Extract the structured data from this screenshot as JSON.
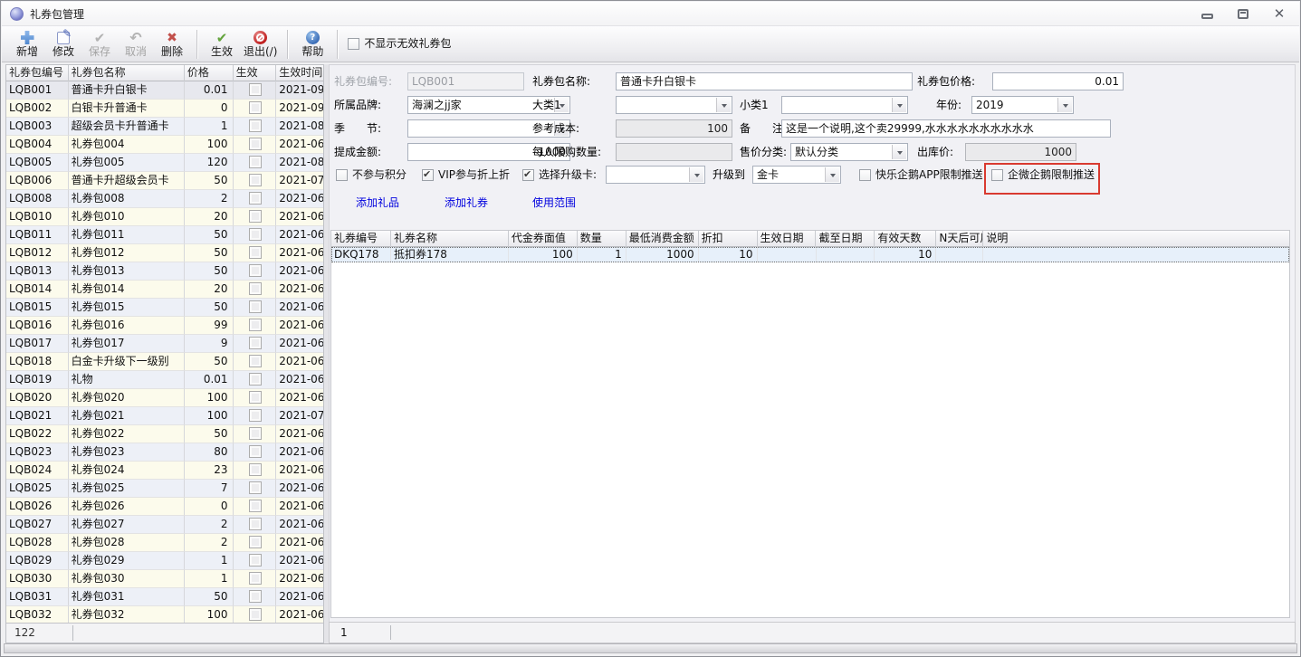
{
  "window": {
    "title": "礼券包管理"
  },
  "toolbar": {
    "buttons": [
      {
        "label": "新增",
        "enabled": true
      },
      {
        "label": "修改",
        "enabled": true
      },
      {
        "label": "保存",
        "enabled": false
      },
      {
        "label": "取消",
        "enabled": false
      },
      {
        "label": "删除",
        "enabled": true
      },
      {
        "label": "生效",
        "enabled": true
      },
      {
        "label": "退出(/)",
        "enabled": true
      },
      {
        "label": "帮助",
        "enabled": true
      }
    ],
    "filter_checkbox": {
      "label": "不显示无效礼券包",
      "checked": false
    }
  },
  "left_table": {
    "columns": [
      "礼券包编号",
      "礼券包名称",
      "价格",
      "生效",
      "生效时间"
    ],
    "footer_count": "122",
    "rows": [
      {
        "code": "LQB001",
        "name": "普通卡升白银卡",
        "price": "0.01",
        "active": false,
        "date": "2021-09"
      },
      {
        "code": "LQB002",
        "name": "白银卡升普通卡",
        "price": "0",
        "active": false,
        "date": "2021-09"
      },
      {
        "code": "LQB003",
        "name": "超级会员卡升普通卡",
        "price": "1",
        "active": false,
        "date": "2021-08"
      },
      {
        "code": "LQB004",
        "name": "礼券包004",
        "price": "100",
        "active": false,
        "date": "2021-06"
      },
      {
        "code": "LQB005",
        "name": "礼券包005",
        "price": "120",
        "active": false,
        "date": "2021-08"
      },
      {
        "code": "LQB006",
        "name": "普通卡升超级会员卡",
        "price": "50",
        "active": false,
        "date": "2021-07"
      },
      {
        "code": "LQB008",
        "name": "礼券包008",
        "price": "2",
        "active": false,
        "date": "2021-06"
      },
      {
        "code": "LQB010",
        "name": "礼券包010",
        "price": "20",
        "active": false,
        "date": "2021-06"
      },
      {
        "code": "LQB011",
        "name": "礼券包011",
        "price": "50",
        "active": false,
        "date": "2021-06"
      },
      {
        "code": "LQB012",
        "name": "礼券包012",
        "price": "50",
        "active": false,
        "date": "2021-06"
      },
      {
        "code": "LQB013",
        "name": "礼券包013",
        "price": "50",
        "active": false,
        "date": "2021-06"
      },
      {
        "code": "LQB014",
        "name": "礼券包014",
        "price": "20",
        "active": false,
        "date": "2021-06"
      },
      {
        "code": "LQB015",
        "name": "礼券包015",
        "price": "50",
        "active": false,
        "date": "2021-06"
      },
      {
        "code": "LQB016",
        "name": "礼券包016",
        "price": "99",
        "active": false,
        "date": "2021-06"
      },
      {
        "code": "LQB017",
        "name": "礼券包017",
        "price": "9",
        "active": false,
        "date": "2021-06"
      },
      {
        "code": "LQB018",
        "name": "白金卡升级下一级别",
        "price": "50",
        "active": false,
        "date": "2021-06"
      },
      {
        "code": "LQB019",
        "name": "礼物",
        "price": "0.01",
        "active": false,
        "date": "2021-06"
      },
      {
        "code": "LQB020",
        "name": "礼券包020",
        "price": "100",
        "active": false,
        "date": "2021-06"
      },
      {
        "code": "LQB021",
        "name": "礼券包021",
        "price": "100",
        "active": false,
        "date": "2021-07"
      },
      {
        "code": "LQB022",
        "name": "礼券包022",
        "price": "50",
        "active": false,
        "date": "2021-06"
      },
      {
        "code": "LQB023",
        "name": "礼券包023",
        "price": "80",
        "active": false,
        "date": "2021-06"
      },
      {
        "code": "LQB024",
        "name": "礼券包024",
        "price": "23",
        "active": false,
        "date": "2021-06"
      },
      {
        "code": "LQB025",
        "name": "礼券包025",
        "price": "7",
        "active": false,
        "date": "2021-06"
      },
      {
        "code": "LQB026",
        "name": "礼券包026",
        "price": "0",
        "active": false,
        "date": "2021-06"
      },
      {
        "code": "LQB027",
        "name": "礼券包027",
        "price": "2",
        "active": false,
        "date": "2021-06"
      },
      {
        "code": "LQB028",
        "name": "礼券包028",
        "price": "2",
        "active": false,
        "date": "2021-06"
      },
      {
        "code": "LQB029",
        "name": "礼券包029",
        "price": "1",
        "active": false,
        "date": "2021-06"
      },
      {
        "code": "LQB030",
        "name": "礼券包030",
        "price": "1",
        "active": false,
        "date": "2021-06"
      },
      {
        "code": "LQB031",
        "name": "礼券包031",
        "price": "50",
        "active": false,
        "date": "2021-06"
      },
      {
        "code": "LQB032",
        "name": "礼券包032",
        "price": "100",
        "active": false,
        "date": "2021-06"
      }
    ]
  },
  "form": {
    "code_label": "礼券包编号:",
    "code_value": "LQB001",
    "name_label": "礼券包名称:",
    "name_value": "普通卡升白银卡",
    "price_label": "礼券包价格:",
    "price_value": "0.01",
    "brand_label": "所属品牌:",
    "brand_value": "海澜之jj家",
    "cat1_label": "大类1",
    "cat1_value": "",
    "subcat1_label": "小类1",
    "subcat1_value": "",
    "year_label": "年份:",
    "year_value": "2019",
    "season_label": "季　　节:",
    "season_value": "",
    "refcost_label": "参考成本:",
    "refcost_value": "100",
    "remark_label": "备　　注:",
    "remark_value": "这是一个说明,这个卖29999,水水水水水水水水水水",
    "commission_label": "提成金额:",
    "commission_value": "1000",
    "limit_label": "每人限购数量:",
    "limit_value": "",
    "pricecat_label": "售价分类:",
    "pricecat_value": "默认分类",
    "outprice_label": "出库价:",
    "outprice_value": "1000",
    "cb_no_points": {
      "label": "不参与积分",
      "checked": false
    },
    "cb_vip": {
      "label": "VIP参与折上折",
      "checked": true
    },
    "cb_upgrade": {
      "label": "选择升级卡:",
      "checked": true
    },
    "upgrade_card_value": "",
    "upgrade_to_label": "升级到",
    "upgrade_to_value": "金卡",
    "cb_app_push": {
      "label": "快乐企鹅APP限制推送",
      "checked": false
    },
    "cb_wecom_push": {
      "label": "企微企鹅限制推送",
      "checked": false
    }
  },
  "links": {
    "add_gift": "添加礼品",
    "add_voucher": "添加礼券",
    "usage_scope": "使用范围"
  },
  "detail_table": {
    "columns": [
      "礼券编号",
      "礼券名称",
      "代金券面值",
      "数量",
      "最低消费金额",
      "折扣",
      "生效日期",
      "截至日期",
      "有效天数",
      "N天后可用",
      "说明"
    ],
    "footer_count": "1",
    "rows": [
      {
        "cells": [
          "DKQ178",
          "抵扣券178",
          "100",
          "1",
          "1000",
          "10",
          "",
          "",
          "10",
          "",
          ""
        ]
      }
    ]
  },
  "colors": {
    "link_blue": "#0000DE",
    "highlight_red": "#D93A30",
    "row_cream": "#FCFBEC",
    "row_blue": "#EDF0F7",
    "selected_row": "#E7E8EE"
  }
}
